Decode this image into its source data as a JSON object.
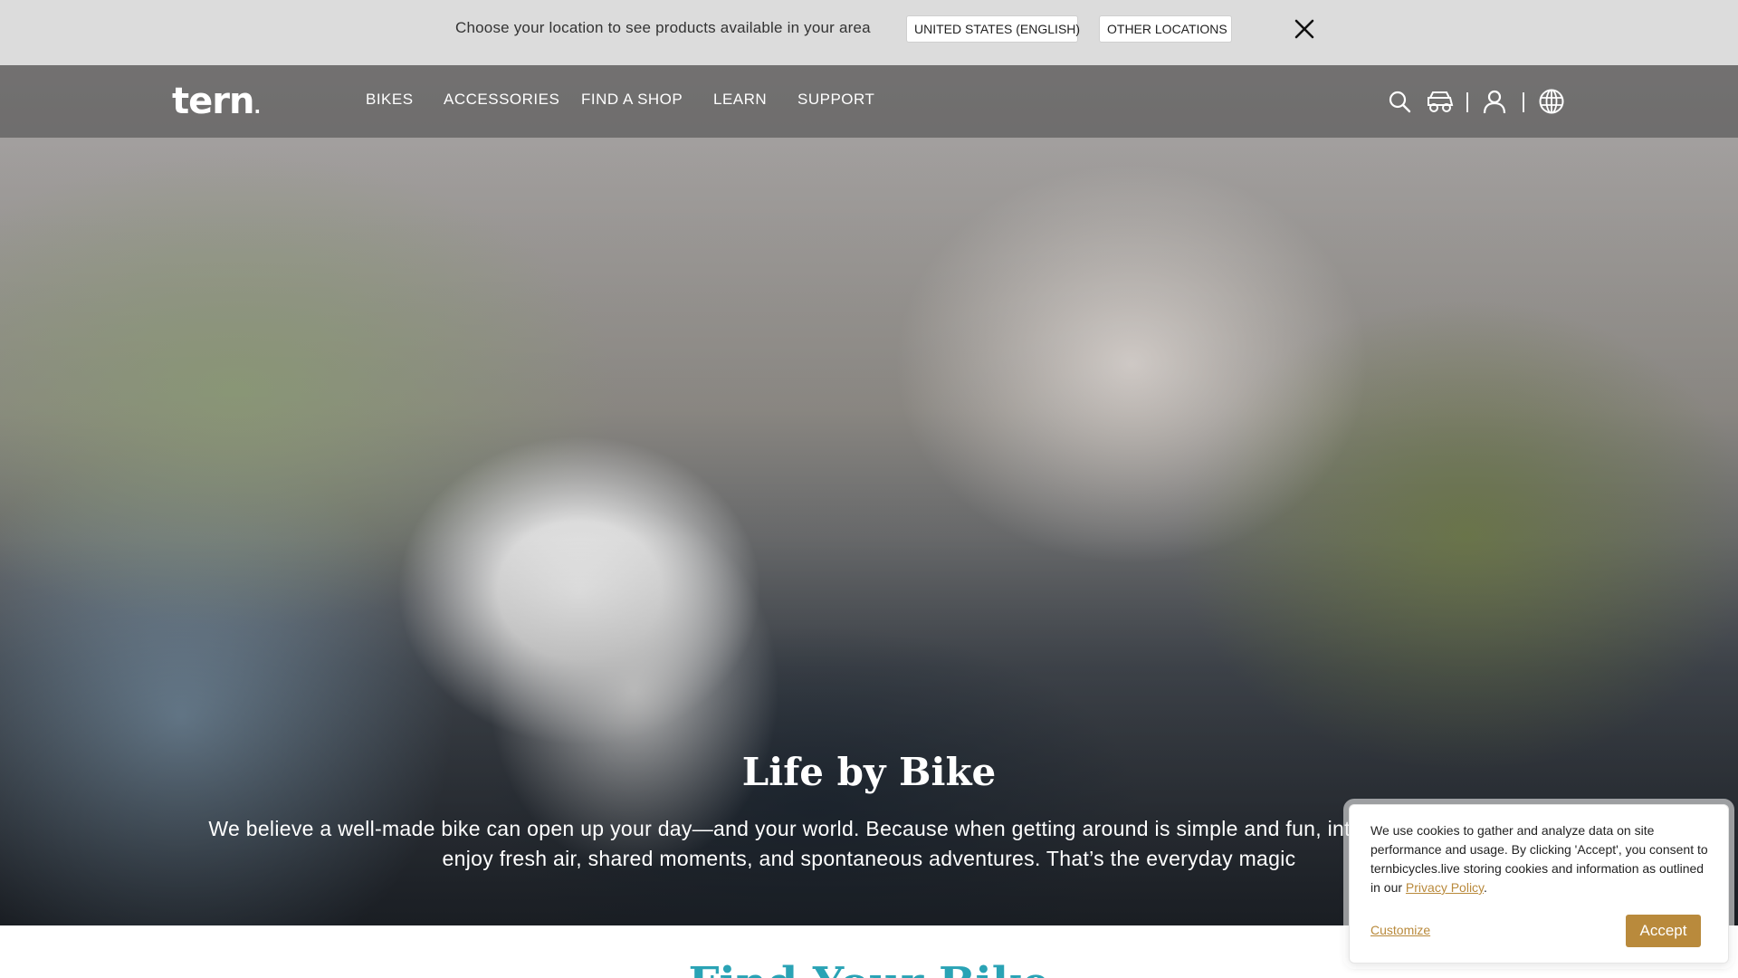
{
  "location_bar": {
    "message": "Choose your location to see products available in your area",
    "us_button": "UNITED STATES (ENGLISH)",
    "other_button": "OTHER LOCATIONS"
  },
  "nav": {
    "logo": "tern",
    "items": [
      "BIKES",
      "ACCESSORIES",
      "FIND A SHOP",
      "LEARN",
      "SUPPORT"
    ],
    "icons": [
      "search-icon",
      "bike-icon",
      "user-icon",
      "globe-icon"
    ]
  },
  "hero": {
    "title": "Life by Bike",
    "description": "We believe a well-made bike can open up your day—and your world. Because when getting around is simple and fun, into place, letting you enjoy fresh air, shared moments, and spontaneous adventures. That’s the everyday magic"
  },
  "section": {
    "heading": "Find Your Bike"
  },
  "cookie": {
    "text_before": "We use cookies to gather and analyze data on site performance and usage. By clicking 'Accept', you consent to ternbicycles.live storing cookies and information as outlined in our ",
    "privacy_link": "Privacy Policy",
    "text_after": ".",
    "customize": "Customize",
    "accept": "Accept"
  },
  "colors": {
    "accent": "#b98a3c",
    "heading_teal": "#2aa3b5",
    "location_bar_bg": "#dcdcdc"
  }
}
